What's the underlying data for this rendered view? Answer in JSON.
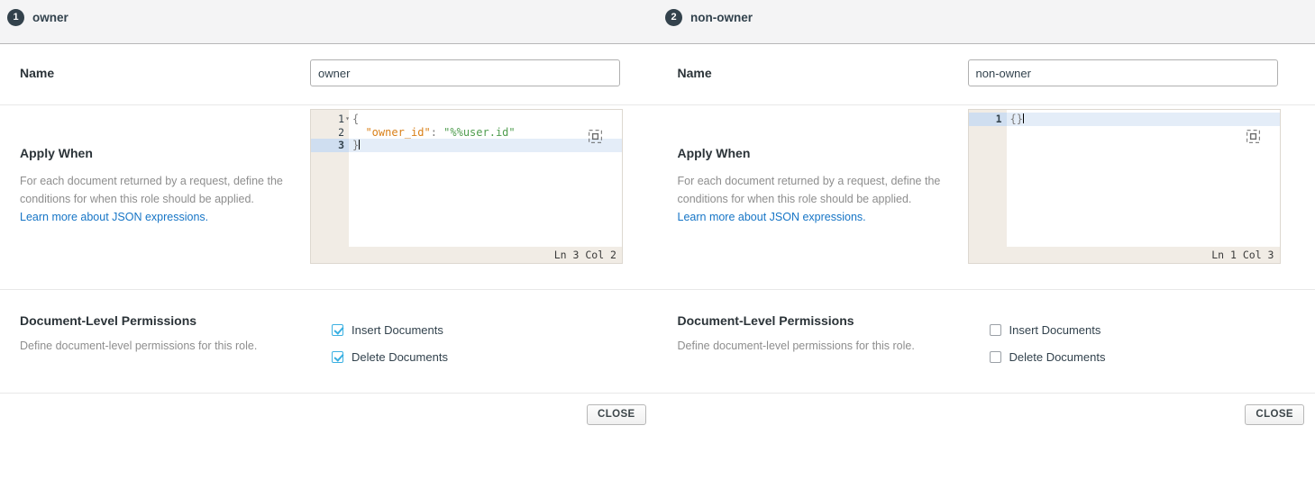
{
  "tabs": [
    {
      "number": "1",
      "label": "owner"
    },
    {
      "number": "2",
      "label": "non-owner"
    }
  ],
  "panes": [
    {
      "name_label": "Name",
      "name_value": "owner",
      "name_placeholder": "Name",
      "apply_when": {
        "title": "Apply When",
        "description": "For each document returned by a request, define the conditions for when this role should be applied.",
        "link": "Learn more about JSON expressions."
      },
      "editor": {
        "lines": [
          {
            "number": "1",
            "fold": "▾",
            "active": false
          },
          {
            "number": "2",
            "fold": "",
            "active": false
          },
          {
            "number": "3",
            "fold": "",
            "active": true
          }
        ],
        "code": {
          "line1_open": "{",
          "line2_key": "\"owner_id\"",
          "line2_colon": ": ",
          "line2_value": "\"%%user.id\"",
          "line3_close": "}"
        },
        "status": "Ln 3 Col 2",
        "expand_icon": "expand-icon"
      },
      "permissions": {
        "title": "Document-Level Permissions",
        "description": "Define document-level permissions for this role.",
        "items": [
          {
            "label": "Insert Documents",
            "checked": true
          },
          {
            "label": "Delete Documents",
            "checked": true
          }
        ]
      },
      "close_label": "CLOSE"
    },
    {
      "name_label": "Name",
      "name_value": "non-owner",
      "name_placeholder": "Name",
      "apply_when": {
        "title": "Apply When",
        "description": "For each document returned by a request, define the conditions for when this role should be applied.",
        "link": "Learn more about JSON expressions."
      },
      "editor": {
        "lines": [
          {
            "number": "1",
            "fold": "",
            "active": true
          }
        ],
        "code": {
          "line1_open": "{}"
        },
        "status": "Ln 1 Col 3",
        "expand_icon": "expand-icon"
      },
      "permissions": {
        "title": "Document-Level Permissions",
        "description": "Define document-level permissions for this role.",
        "items": [
          {
            "label": "Insert Documents",
            "checked": false
          },
          {
            "label": "Delete Documents",
            "checked": false
          }
        ]
      },
      "close_label": "CLOSE"
    }
  ],
  "colors": {
    "badge": "#33424c",
    "link": "#1675c6",
    "checkbox_checked": "#3ab0e2",
    "header_bg": "#f4f4f5",
    "editor_gutter": "#f1ece5",
    "active_line": "#e4edf8",
    "json_key": "#d98019",
    "json_string": "#4f9d4f"
  }
}
